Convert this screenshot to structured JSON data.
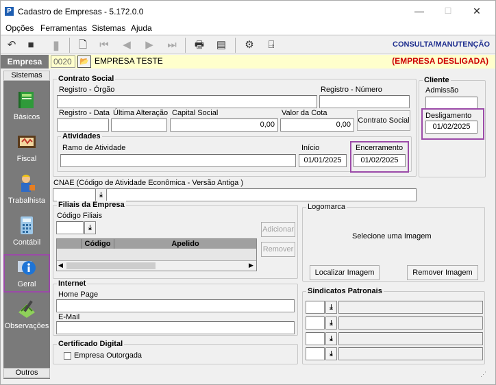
{
  "window": {
    "title": "Cadastro de Empresas - 5.172.0.0",
    "minimize": "—",
    "maximize": "☐",
    "close": "✕"
  },
  "menu": [
    "Opções",
    "Ferramentas",
    "Sistemas",
    "Ajuda"
  ],
  "toolbar": {
    "mode": "CONSULTA/MANUTENÇÃO"
  },
  "empresa": {
    "label": "Empresa",
    "code": "0020",
    "name": "EMPRESA TESTE",
    "status": "(EMPRESA DESLIGADA)"
  },
  "sidebar": {
    "header": "Sistemas",
    "footer": "Outros",
    "items": [
      {
        "label": "Básicos",
        "icon": "book-icon"
      },
      {
        "label": "Fiscal",
        "icon": "fiscal-icon"
      },
      {
        "label": "Trabalhista",
        "icon": "worker-icon"
      },
      {
        "label": "Contábil",
        "icon": "calculator-icon"
      },
      {
        "label": "Geral",
        "icon": "info-icon"
      },
      {
        "label": "Observações",
        "icon": "notes-icon"
      }
    ]
  },
  "contrato": {
    "title": "Contrato Social",
    "registro_orgao_label": "Registro - Órgão",
    "registro_orgao": "",
    "registro_numero_label": "Registro - Número",
    "registro_numero": "",
    "registro_data_label": "Registro - Data",
    "registro_data": "",
    "ultima_alteracao_label": "Última Alteração",
    "ultima_alteracao": "",
    "capital_social_label": "Capital Social",
    "capital_social": "0,00",
    "valor_cota_label": "Valor da Cota",
    "valor_cota": "0,00",
    "contrato_button": "Contrato Social"
  },
  "atividades": {
    "title": "Atividades",
    "ramo_label": "Ramo de Atividade",
    "ramo": "",
    "inicio_label": "Início",
    "inicio": "01/01/2025",
    "encerramento_label": "Encerramento",
    "encerramento": "01/02/2025"
  },
  "cliente": {
    "title": "Cliente",
    "admissao_label": "Admissão",
    "admissao": "",
    "desligamento_label": "Desligamento",
    "desligamento": "01/02/2025"
  },
  "cnae": {
    "label": "CNAE (Código de Atividade Econômica - Versão Antiga )",
    "value": ""
  },
  "filiais": {
    "title": "Filiais da Empresa",
    "codigo_label": "Código Filiais",
    "columns": [
      "Código",
      "Apelido"
    ],
    "add_button": "Adicionar",
    "remove_button": "Remover"
  },
  "logomarca": {
    "title": "Logomarca",
    "placeholder": "Selecione  uma  Imagem",
    "locate_button": "Localizar Imagem",
    "remove_button": "Remover Imagem"
  },
  "internet": {
    "title": "Internet",
    "home_label": "Home Page",
    "home": "",
    "email_label": "E-Mail",
    "email": ""
  },
  "certificado": {
    "title": "Certificado Digital",
    "outorgada_label": "Empresa Outorgada"
  },
  "sindicatos": {
    "title": "Sindicatos Patronais"
  }
}
